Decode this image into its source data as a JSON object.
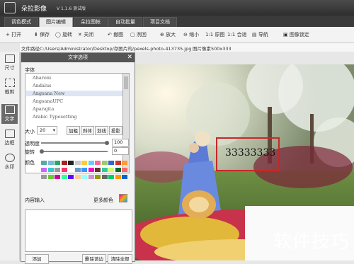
{
  "app": {
    "title": "朵拉影像",
    "version": "V 1.1.6 测试版"
  },
  "tabs": [
    {
      "label": "调色模式",
      "active": false
    },
    {
      "label": "图片编辑",
      "active": true
    },
    {
      "label": "朵拉图帐",
      "active": false
    },
    {
      "label": "自动批量",
      "active": false
    },
    {
      "label": "项目文档",
      "active": false
    }
  ],
  "toolbar": {
    "open": "打开",
    "save": "保存",
    "rotate": "旋转",
    "close": "关闭",
    "undo": "撤图",
    "redo": "洌回",
    "zoom_in": "放大",
    "zoom_out": "缩小",
    "actual": "1:1 原图",
    "fit": "1:1 合适",
    "nav": "导航",
    "lock": "图像锁定"
  },
  "path": {
    "label": "文件路径C:",
    "value": "/Users/Administrator/Desktop/存图片的/pexels-photo-413735.jpg",
    "pixels": "图片像素500x333"
  },
  "sidebar": [
    {
      "label": "尺寸",
      "icon": "ruler-icon",
      "active": false
    },
    {
      "label": "裁剪",
      "icon": "crop-icon",
      "active": false
    },
    {
      "label": "文字",
      "icon": "text-icon",
      "active": true
    },
    {
      "label": "边框",
      "icon": "border-icon",
      "active": false
    },
    {
      "label": "水印",
      "icon": "watermark-icon",
      "active": false
    }
  ],
  "dialog": {
    "title": "文字选项",
    "font_label": "字体",
    "fonts": [
      "Aharoni",
      "Andalus",
      "Angsana New",
      "AngsanaUPC",
      "Aparajita",
      "Arabic Typesetting"
    ],
    "selected_font": "Angsana New",
    "size_label": "大小",
    "size_value": "20",
    "style_buttons": [
      "加粗",
      "斜体",
      "划线",
      "投影"
    ],
    "opacity_label": "透明度",
    "opacity_value": "100",
    "rotate_label": "旋转",
    "rotate_value": "0",
    "color_label": "颜色",
    "content_label": "内容输入",
    "more_colors": "更多颜色",
    "add_button": "添加",
    "delete_button": "删除该边",
    "clear_button": "清除全部"
  },
  "overlay_text": "33333333",
  "watermark": "软件技巧",
  "colors": {
    "accent": "#c62828",
    "selected_bg": "#dde6f2"
  }
}
